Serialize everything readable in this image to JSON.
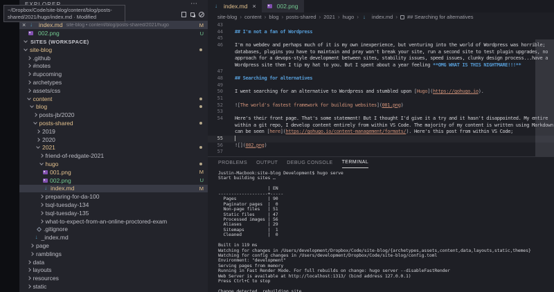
{
  "window": {
    "tooltip": "~/Dropbox/Code/site-blog/content/blog/posts-shared/2021/hugo/index.md · Modified"
  },
  "colors": {
    "git_modified": "#e2c08d",
    "git_untracked": "#73c991",
    "heading_blue": "#569cd6",
    "string_orange": "#ce9178",
    "sidebar_bg": "#23242b",
    "editor_bg": "#1e1f25"
  },
  "glyphs": {
    "close": "×",
    "more": "⋯",
    "breadcrumb_sep": "›",
    "markdown": "↓"
  },
  "sidebar": {
    "title": "EXPLORER",
    "section": "SITES (WORKSPACE)",
    "open_editors": [
      {
        "label": "index.md",
        "description": "site-blog • content/blog/posts-shared/2021/hugo",
        "icon": "markdown",
        "status": "mod",
        "badge": "M",
        "selected": true
      },
      {
        "label": "002.png",
        "description": "",
        "icon": "image",
        "status": "unt",
        "badge": "U",
        "selected": false
      }
    ],
    "tree": [
      {
        "label": "site-blog",
        "level": 0,
        "kind": "folder",
        "expanded": true,
        "status": "mod",
        "badge": "dot"
      },
      {
        "label": ".github",
        "level": 1,
        "kind": "folder",
        "expanded": false
      },
      {
        "label": "#notes",
        "level": 1,
        "kind": "folder",
        "expanded": false
      },
      {
        "label": "#upcoming",
        "level": 1,
        "kind": "folder",
        "expanded": false
      },
      {
        "label": "archetypes",
        "level": 1,
        "kind": "folder",
        "expanded": false
      },
      {
        "label": "assets/css",
        "level": 1,
        "kind": "folder",
        "expanded": false
      },
      {
        "label": "content",
        "level": 1,
        "kind": "folder",
        "expanded": true,
        "status": "mod",
        "badge": "dot"
      },
      {
        "label": "blog",
        "level": 2,
        "kind": "folder",
        "expanded": true,
        "status": "mod",
        "badge": "dot"
      },
      {
        "label": "posts-jb/2020",
        "level": 3,
        "kind": "folder",
        "expanded": false
      },
      {
        "label": "posts-shared",
        "level": 3,
        "kind": "folder",
        "expanded": true,
        "status": "mod",
        "badge": "dot"
      },
      {
        "label": "2019",
        "level": 4,
        "kind": "folder",
        "expanded": false
      },
      {
        "label": "2020",
        "level": 4,
        "kind": "folder",
        "expanded": false
      },
      {
        "label": "2021",
        "level": 4,
        "kind": "folder",
        "expanded": true,
        "status": "mod",
        "badge": "dot"
      },
      {
        "label": "friend-of-redgate-2021",
        "level": 5,
        "kind": "folder",
        "expanded": false
      },
      {
        "label": "hugo",
        "level": 5,
        "kind": "folder",
        "expanded": true,
        "status": "mod",
        "badge": "dot"
      },
      {
        "label": "001.png",
        "level": 6,
        "kind": "file",
        "icon": "image",
        "status": "mod",
        "badge": "M"
      },
      {
        "label": "002.png",
        "level": 6,
        "kind": "file",
        "icon": "image",
        "status": "unt",
        "badge": "U"
      },
      {
        "label": "index.md",
        "level": 6,
        "kind": "file",
        "icon": "markdown",
        "status": "mod",
        "badge": "M",
        "selected": true
      },
      {
        "label": "preparing-for-da-100",
        "level": 5,
        "kind": "folder",
        "expanded": false
      },
      {
        "label": "tsql-tuesday-134",
        "level": 5,
        "kind": "folder",
        "expanded": false
      },
      {
        "label": "tsql-tuesday-135",
        "level": 5,
        "kind": "folder",
        "expanded": false
      },
      {
        "label": "what-to-expect-from-an-online-proctored-exam",
        "level": 5,
        "kind": "folder",
        "expanded": false
      },
      {
        "label": ".gitignore",
        "level": 4,
        "kind": "file",
        "icon": "git"
      },
      {
        "label": "_index.md",
        "level": 3,
        "kind": "file",
        "icon": "markdown"
      },
      {
        "label": "page",
        "level": 2,
        "kind": "folder",
        "expanded": false
      },
      {
        "label": "ramblings",
        "level": 2,
        "kind": "folder",
        "expanded": false
      },
      {
        "label": "data",
        "level": 1,
        "kind": "folder",
        "expanded": false
      },
      {
        "label": "layouts",
        "level": 1,
        "kind": "folder",
        "expanded": false
      },
      {
        "label": "resources",
        "level": 1,
        "kind": "folder",
        "expanded": false
      },
      {
        "label": "static",
        "level": 1,
        "kind": "folder",
        "expanded": false
      }
    ]
  },
  "editor_tabs": [
    {
      "label": "index.md",
      "icon": "markdown",
      "status": "mod",
      "active": true,
      "has_close": true
    },
    {
      "label": "002.png",
      "icon": "image",
      "status": "unt",
      "active": false,
      "has_close": false
    }
  ],
  "breadcrumb": {
    "path": [
      "site-blog",
      "content",
      "blog",
      "posts-shared",
      "2021",
      "hugo"
    ],
    "file": "index.md",
    "symbol": "## Searching for alternatives"
  },
  "editor": {
    "lines": [
      {
        "n": "43",
        "seg": []
      },
      {
        "n": "44",
        "seg": [
          [
            "head",
            "## I'm not a fan of Wordpress"
          ]
        ]
      },
      {
        "n": "45",
        "seg": []
      },
      {
        "n": "46",
        "seg": [
          [
            "plain",
            "I'm no webdev and perhaps much of it is my own inexperience, but venturing into the world of Wordpress was horrible;"
          ]
        ]
      },
      {
        "n": "",
        "seg": [
          [
            "plain",
            "databases, plugins you have to maintain and pray won't break your site, run a second site to test plugin upgrades, no"
          ]
        ]
      },
      {
        "n": "",
        "seg": [
          [
            "plain",
            "approach for a devops-style development between sites, stability issues, speed issues, clunky design process...have a"
          ]
        ]
      },
      {
        "n": "",
        "seg": [
          [
            "plain",
            "Wordpress site then I tip my hat to you. But I spent about a year feeling "
          ],
          [
            "bold",
            "**OMG WHAT IS THIS NIGHTMARE!!!**"
          ]
        ]
      },
      {
        "n": "47",
        "seg": []
      },
      {
        "n": "48",
        "seg": [
          [
            "head",
            "## Searching for alternatives"
          ]
        ]
      },
      {
        "n": "49",
        "seg": []
      },
      {
        "n": "50",
        "seg": [
          [
            "plain",
            "I went searching for an alternative to Wordpress and stumbled upon "
          ],
          [
            "punct",
            "["
          ],
          [
            "link",
            "Hugo"
          ],
          [
            "punct",
            "]("
          ],
          [
            "url",
            "https://gohugo.io"
          ],
          [
            "punct",
            ")."
          ]
        ]
      },
      {
        "n": "51",
        "seg": []
      },
      {
        "n": "52",
        "seg": [
          [
            "punct",
            "!["
          ],
          [
            "link",
            "The world's fastest framework for building websites"
          ],
          [
            "punct",
            "]("
          ],
          [
            "url",
            "001.png"
          ],
          [
            "punct",
            ")"
          ]
        ]
      },
      {
        "n": "53",
        "seg": []
      },
      {
        "n": "54",
        "seg": [
          [
            "plain",
            "Here's their front page. That's some statement! But I thought I'd give it a try and it hasn't disappointed. My entire"
          ]
        ]
      },
      {
        "n": "",
        "seg": [
          [
            "plain",
            "within a git repo, I develop content entirely from within VS Code. The majority of my content is written using Markdown"
          ]
        ]
      },
      {
        "n": "",
        "seg": [
          [
            "plain",
            "can be seen "
          ],
          [
            "punct",
            "["
          ],
          [
            "link",
            "here"
          ],
          [
            "punct",
            "]("
          ],
          [
            "url",
            "https://gohugo.io/content-management/formats/"
          ],
          [
            "punct",
            ")."
          ],
          [
            "plain",
            " Here's this post from within VS Code;"
          ]
        ]
      },
      {
        "n": "55",
        "cursor": true,
        "current": true,
        "seg": []
      },
      {
        "n": "56",
        "seg": [
          [
            "punct",
            "![]("
          ],
          [
            "url",
            "002.png"
          ],
          [
            "punct",
            ")"
          ]
        ]
      },
      {
        "n": "57",
        "seg": []
      }
    ]
  },
  "panel": {
    "tabs": [
      "PROBLEMS",
      "OUTPUT",
      "DEBUG CONSOLE",
      "TERMINAL"
    ],
    "active_tab": "TERMINAL",
    "terminal_lines": [
      "Justin-Macbook:site-blog Development$ hugo serve",
      "Start building sites …",
      "",
      "                   | EN  ",
      "-------------------+-----",
      "  Pages            | 90  ",
      "  Paginator pages  |  0  ",
      "  Non-page files   | 51  ",
      "  Static files     | 47  ",
      "  Processed images | 56  ",
      "  Aliases          | 29  ",
      "  Sitemaps         |  1  ",
      "  Cleaned          |  0  ",
      "",
      "Built in 119 ms",
      "Watching for changes in /Users/development/Dropbox/Code/site-blog/{archetypes,assets,content,data,layouts,static,themes}",
      "Watching for config changes in /Users/development/Dropbox/Code/site-blog/config.toml",
      "Environment: \"development\"",
      "Serving pages from memory",
      "Running in Fast Render Mode. For full rebuilds on change: hugo server --disableFastRender",
      "Web Server is available at http://localhost:1313/ (bind address 127.0.0.1)",
      "Press Ctrl+C to stop",
      "",
      "Change detected, rebuilding site."
    ]
  }
}
